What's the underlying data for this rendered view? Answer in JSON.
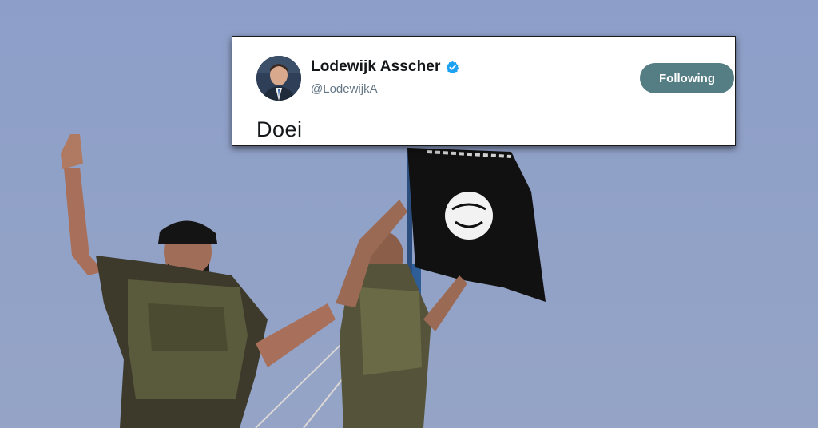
{
  "tweet": {
    "display_name": "Lodewijk Asscher",
    "handle": "@LodewijkA",
    "verified": true,
    "follow_button_label": "Following",
    "text": "Doei",
    "colors": {
      "follow_button": "#547d84",
      "verified_badge": "#1da1f2",
      "handle": "#657786",
      "text": "#14171a"
    }
  },
  "background": {
    "sky_color": "#8fa0c7",
    "flag_color": "#111111"
  }
}
